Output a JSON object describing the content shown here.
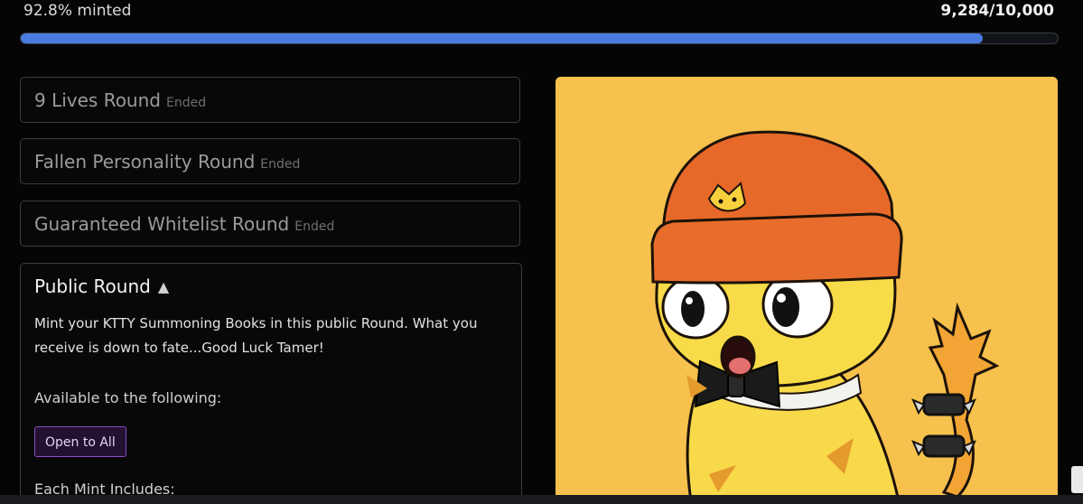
{
  "progress": {
    "minted_label": "92.8% minted",
    "count": "9,284/10,000",
    "fraction": 0.928,
    "color": "#4a7be0"
  },
  "rounds": [
    {
      "title": "9 Lives Round",
      "status": "Ended"
    },
    {
      "title": "Fallen Personality Round",
      "status": "Ended"
    },
    {
      "title": "Guaranteed Whitelist Round",
      "status": "Ended"
    }
  ],
  "public_round": {
    "title": "Public Round",
    "toggle_icon": "triangle-up-icon",
    "description": "Mint your KTTY Summoning Books in this public Round. What you receive is down to fate...Good Luck Tamer!",
    "available_label": "Available to the following:",
    "access_badge": "Open to All",
    "includes_label": "Each Mint Includes:"
  },
  "artwork": {
    "background": "#f6c14d",
    "subject": "cat-artwork"
  }
}
